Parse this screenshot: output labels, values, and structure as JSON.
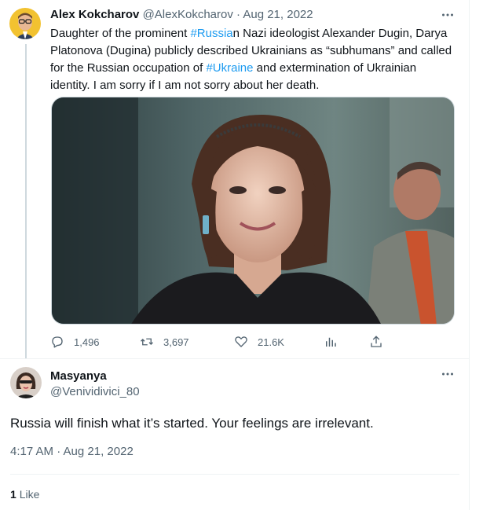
{
  "parent_tweet": {
    "author_name": "Alex Kokcharov",
    "author_handle": "@AlexKokcharov",
    "separator": "·",
    "date": "Aug 21, 2022",
    "text_segments": [
      {
        "text": "Daughter of the prominent ",
        "type": "text"
      },
      {
        "text": "#Russia",
        "type": "hashtag"
      },
      {
        "text": "n Nazi ideologist Alexander Dugin, Darya Platonova (Dugina) publicly described Ukrainians as “subhumans” and called for the Russian occupation of ",
        "type": "text"
      },
      {
        "text": "#Ukraine",
        "type": "hashtag"
      },
      {
        "text": " and extermination of Ukrainian identity. I am sorry if I am not sorry about her death.",
        "type": "text"
      }
    ],
    "metrics": {
      "replies": "1,496",
      "retweets": "3,697",
      "likes": "21.6K"
    },
    "more_icon": "ellipsis-icon"
  },
  "reply_tweet": {
    "author_name": "Masyanya",
    "author_handle": "@Venividivici_80",
    "text": "Russia will finish what it’s started.  Your feelings are irrelevant.",
    "timestamp": "4:17 AM · Aug 21, 2022",
    "like_count": "1",
    "like_label": "Like",
    "more_icon": "ellipsis-icon"
  },
  "colors": {
    "link": "#1d9bf0",
    "secondary_text": "#536471",
    "primary_text": "#0f1419",
    "divider": "#eff3f4"
  }
}
